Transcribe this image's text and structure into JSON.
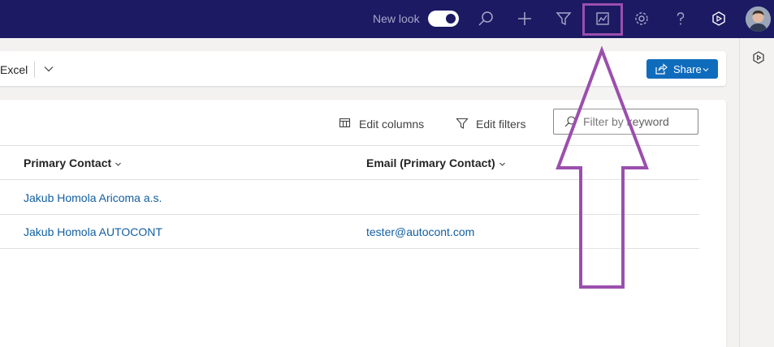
{
  "topbar": {
    "new_look_label": "New look",
    "new_look_enabled": true,
    "icons": [
      "search-icon",
      "add-icon",
      "filter-icon",
      "insights-icon",
      "settings-icon",
      "help-icon",
      "copilot-icon"
    ],
    "avatar": "user-avatar"
  },
  "commandbar": {
    "excel_label": "Excel",
    "share_label": "Share"
  },
  "grid": {
    "toolbar": {
      "edit_columns_label": "Edit columns",
      "edit_filters_label": "Edit filters",
      "filter_placeholder": "Filter by keyword"
    },
    "columns": [
      "Primary Contact",
      "Email (Primary Contact)"
    ],
    "rows": [
      {
        "primary_contact": "Jakub Homola Aricoma a.s.",
        "email": ""
      },
      {
        "primary_contact": "Jakub Homola AUTOCONT",
        "email": "tester@autocont.com"
      }
    ]
  },
  "colors": {
    "topbar_bg": "#1b1a63",
    "accent": "#0f6cbd",
    "link": "#115ea3",
    "annotation": "#9b4fad"
  }
}
